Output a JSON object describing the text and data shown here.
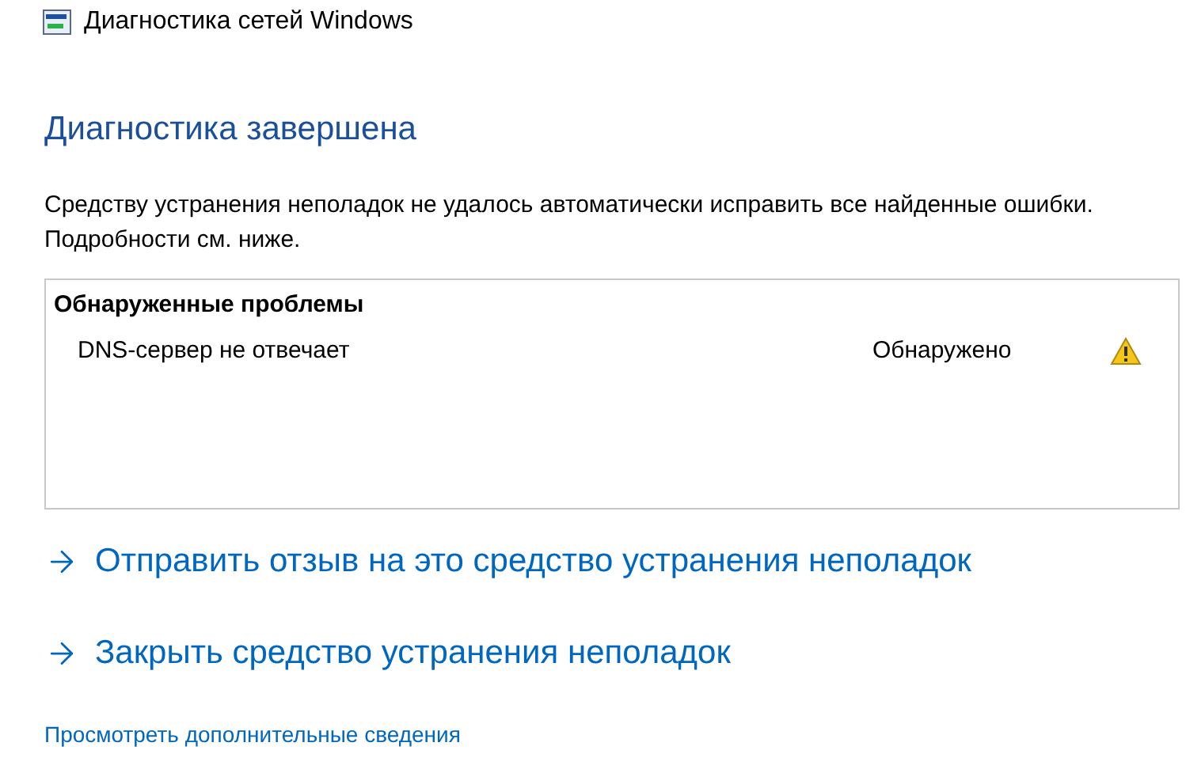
{
  "window": {
    "title": "Диагностика сетей Windows"
  },
  "heading": "Диагностика завершена",
  "message": "Средству устранения неполадок не удалось автоматически исправить все найденные ошибки. Подробности см. ниже.",
  "problems": {
    "title": "Обнаруженные проблемы",
    "items": [
      {
        "name": "DNS-сервер не отвечает",
        "status": "Обнаружено",
        "kind": "warning"
      }
    ]
  },
  "actions": [
    "Отправить отзыв на это средство устранения неполадок",
    "Закрыть средство устранения неполадок"
  ],
  "more_link": "Просмотреть дополнительные сведения"
}
